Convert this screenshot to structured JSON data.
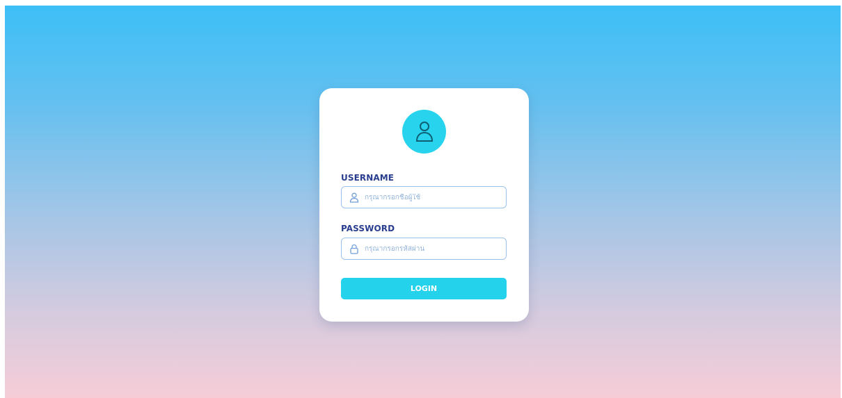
{
  "login_form": {
    "username": {
      "label": "USERNAME",
      "placeholder": "กรุณากรอกชื่อผู้ใช้",
      "value": "",
      "icon": "user-icon"
    },
    "password": {
      "label": "PASSWORD",
      "placeholder": "กรุณากรอกรหัสผ่าน",
      "value": "",
      "icon": "lock-icon"
    },
    "submit_label": "LOGIN",
    "avatar_icon": "user-avatar-icon"
  },
  "colors": {
    "accent": "#25d2ec",
    "label": "#2a3e8f",
    "input_border": "#9cc2ea",
    "gradient_top": "#3dbff6",
    "gradient_bottom": "#f6cdd7"
  }
}
